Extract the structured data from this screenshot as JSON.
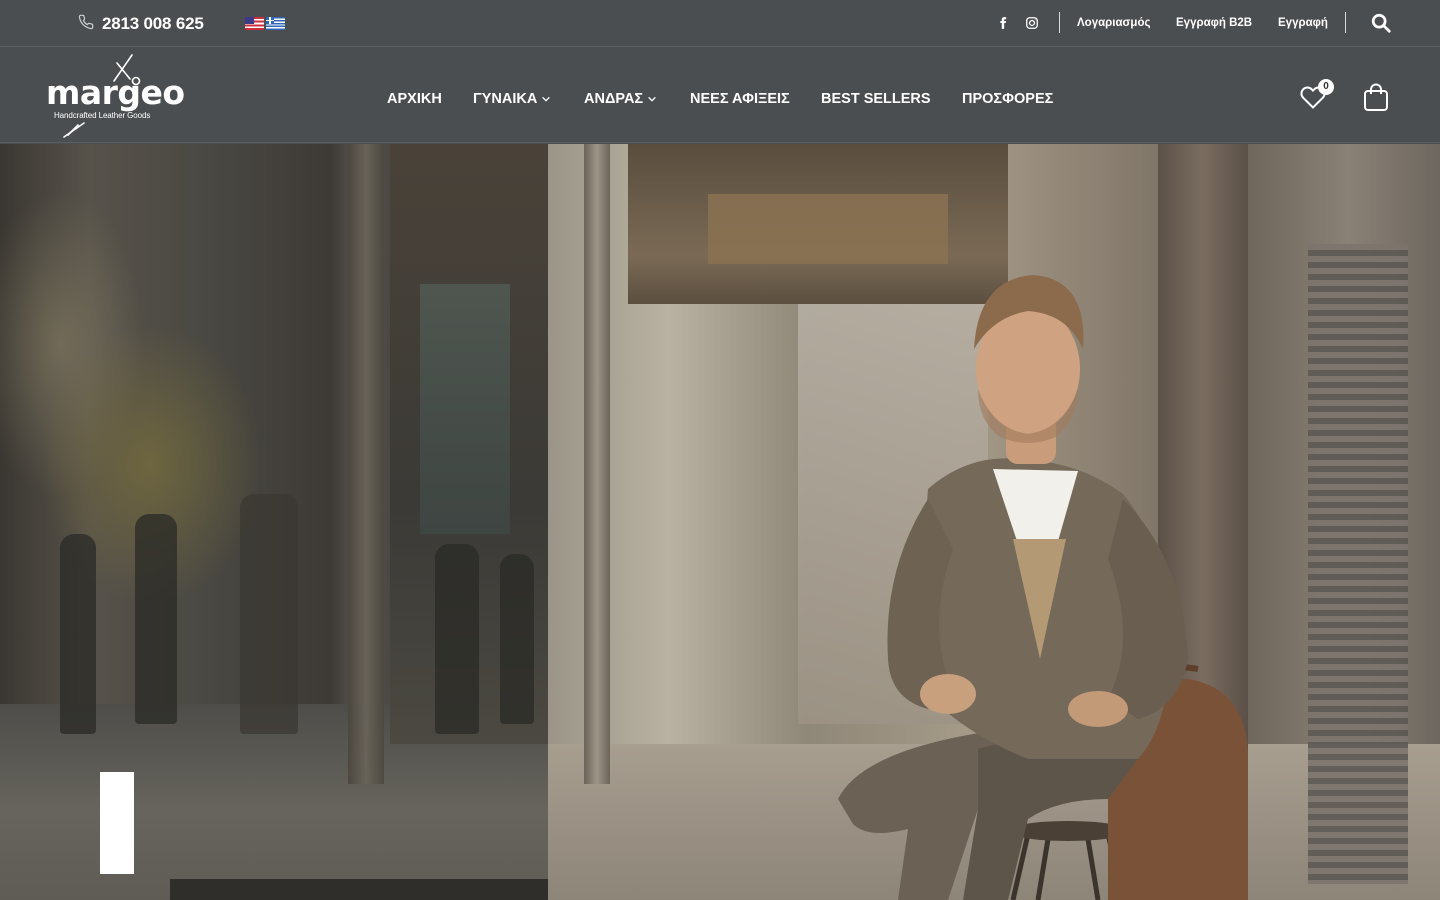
{
  "topbar": {
    "phone_icon": "phone-icon",
    "phone": "2813 008 625",
    "languages": [
      "en-flag-icon",
      "el-flag-icon"
    ],
    "social": [
      "facebook-icon",
      "instagram-icon"
    ],
    "links": {
      "account": "Λογαριασμός",
      "b2b_register": "Εγγραφή B2B",
      "register": "Εγγραφή"
    },
    "search_icon": "search-icon"
  },
  "header": {
    "logo": {
      "word": "margeo",
      "tagline": "Handcrafted Leather Goods"
    },
    "nav": [
      {
        "label": "ΑΡΧΙΚΗ",
        "has_dropdown": false
      },
      {
        "label": "ΓΥΝΑΙΚΑ",
        "has_dropdown": true
      },
      {
        "label": "ΑΝΔΡΑΣ",
        "has_dropdown": true
      },
      {
        "label": "ΝΕΕΣ ΑΦΙΞΕΙΣ",
        "has_dropdown": false
      },
      {
        "label": "BEST SELLERS",
        "has_dropdown": false
      },
      {
        "label": "ΠΡΟΣΦΟΡΕΣ",
        "has_dropdown": false
      }
    ],
    "wishlist_icon": "heart-icon",
    "wishlist_count": "0",
    "cart_icon": "shopping-bag-icon"
  },
  "colors": {
    "header_bg": "#4b4e51",
    "text": "#ffffff"
  }
}
